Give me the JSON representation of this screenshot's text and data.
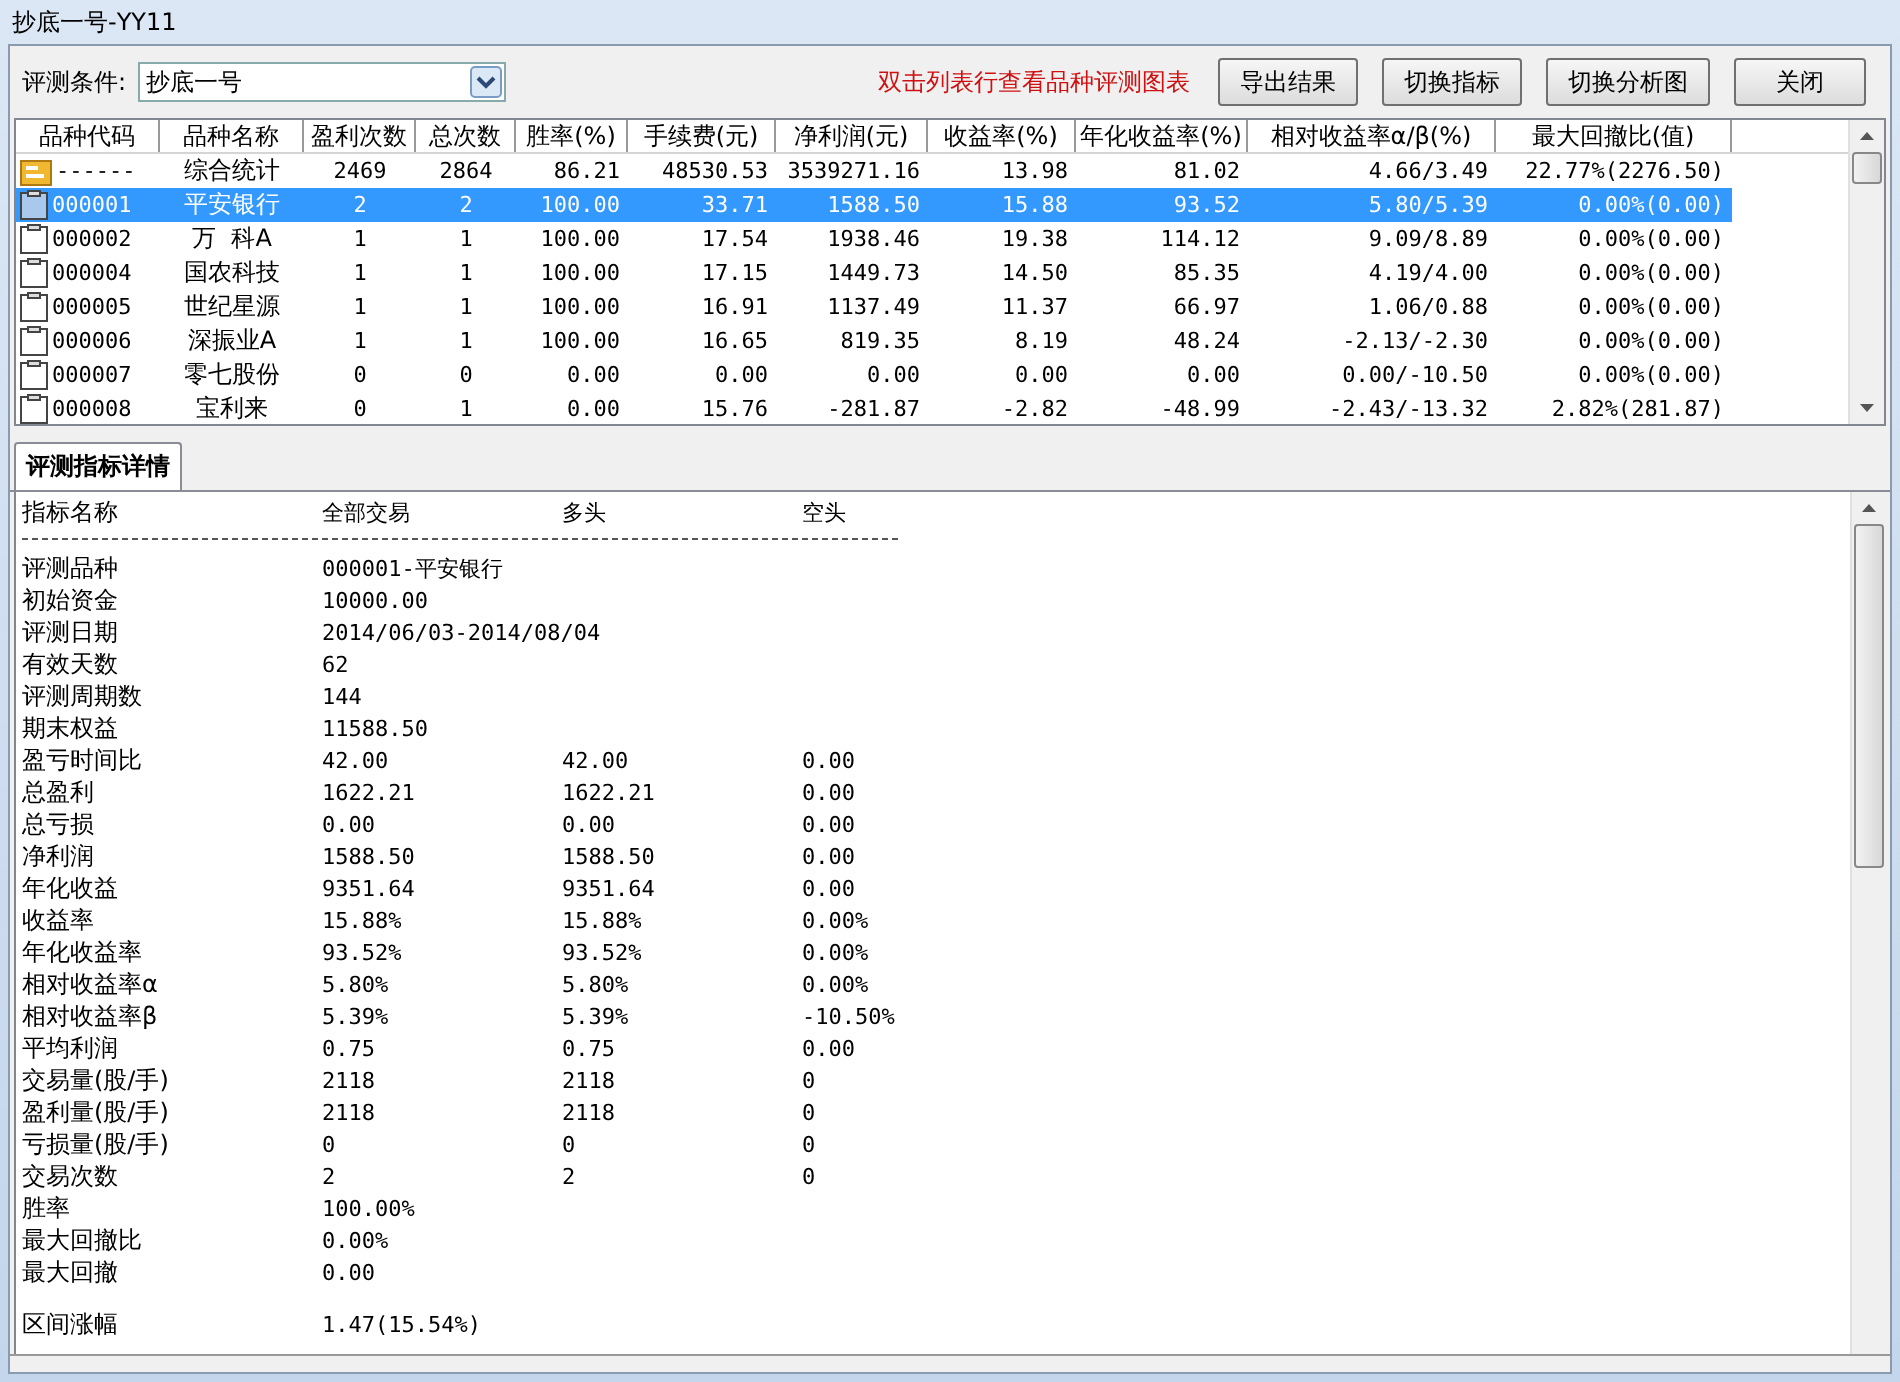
{
  "window": {
    "title": "抄底一号-YY11"
  },
  "toolbar": {
    "condition_label": "评测条件:",
    "condition_value": "抄底一号",
    "hint": "双击列表行查看品种评测图表",
    "buttons": [
      "导出结果",
      "切换指标",
      "切换分析图",
      "关闭"
    ]
  },
  "table": {
    "columns": [
      "品种代码",
      "品种名称",
      "盈利次数",
      "总次数",
      "胜率(%)",
      "手续费(元)",
      "净利润(元)",
      "收益率(%)",
      "年化收益率(%)",
      "相对收益率α/β(%)",
      "最大回撤比(值)"
    ],
    "rows": [
      {
        "kind": "summary",
        "selected": false,
        "cells": [
          "------",
          "综合统计",
          "2469",
          "2864",
          "86.21",
          "48530.53",
          "3539271.16",
          "13.98",
          "81.02",
          "4.66/3.49",
          "22.77%(2276.50)"
        ]
      },
      {
        "kind": "stock",
        "selected": true,
        "cells": [
          "000001",
          "平安银行",
          "2",
          "2",
          "100.00",
          "33.71",
          "1588.50",
          "15.88",
          "93.52",
          "5.80/5.39",
          "0.00%(0.00)"
        ]
      },
      {
        "kind": "stock",
        "selected": false,
        "cells": [
          "000002",
          "万  科A",
          "1",
          "1",
          "100.00",
          "17.54",
          "1938.46",
          "19.38",
          "114.12",
          "9.09/8.89",
          "0.00%(0.00)"
        ]
      },
      {
        "kind": "stock",
        "selected": false,
        "cells": [
          "000004",
          "国农科技",
          "1",
          "1",
          "100.00",
          "17.15",
          "1449.73",
          "14.50",
          "85.35",
          "4.19/4.00",
          "0.00%(0.00)"
        ]
      },
      {
        "kind": "stock",
        "selected": false,
        "cells": [
          "000005",
          "世纪星源",
          "1",
          "1",
          "100.00",
          "16.91",
          "1137.49",
          "11.37",
          "66.97",
          "1.06/0.88",
          "0.00%(0.00)"
        ]
      },
      {
        "kind": "stock",
        "selected": false,
        "cells": [
          "000006",
          "深振业A",
          "1",
          "1",
          "100.00",
          "16.65",
          "819.35",
          "8.19",
          "48.24",
          "-2.13/-2.30",
          "0.00%(0.00)"
        ]
      },
      {
        "kind": "stock",
        "selected": false,
        "cells": [
          "000007",
          "零七股份",
          "0",
          "0",
          "0.00",
          "0.00",
          "0.00",
          "0.00",
          "0.00",
          "0.00/-10.50",
          "0.00%(0.00)"
        ]
      },
      {
        "kind": "stock",
        "selected": false,
        "cells": [
          "000008",
          "宝利来",
          "0",
          "1",
          "0.00",
          "15.76",
          "-281.87",
          "-2.82",
          "-48.99",
          "-2.43/-13.32",
          "2.82%(281.87)"
        ]
      }
    ]
  },
  "tabs": [
    {
      "label": "评测指标详情",
      "selected": true
    }
  ],
  "detail": {
    "columns": [
      "指标名称",
      "全部交易",
      "多头",
      "空头"
    ],
    "rows": [
      [
        "评测品种",
        "000001-平安银行"
      ],
      [
        "初始资金",
        "10000.00"
      ],
      [
        "评测日期",
        "2014/06/03-2014/08/04"
      ],
      [
        "有效天数",
        "62"
      ],
      [
        "评测周期数",
        "144"
      ],
      [
        "期末权益",
        "11588.50"
      ],
      [
        "盈亏时间比",
        "42.00",
        "42.00",
        "0.00"
      ],
      [
        "总盈利",
        "1622.21",
        "1622.21",
        "0.00"
      ],
      [
        "总亏损",
        "0.00",
        "0.00",
        "0.00"
      ],
      [
        "净利润",
        "1588.50",
        "1588.50",
        "0.00"
      ],
      [
        "年化收益",
        "9351.64",
        "9351.64",
        "0.00"
      ],
      [
        "收益率",
        "15.88%",
        "15.88%",
        "0.00%"
      ],
      [
        "年化收益率",
        "93.52%",
        "93.52%",
        "0.00%"
      ],
      [
        "相对收益率α",
        "5.80%",
        "5.80%",
        "0.00%"
      ],
      [
        "相对收益率β",
        "5.39%",
        "5.39%",
        "-10.50%"
      ],
      [
        "平均利润",
        "0.75",
        "0.75",
        "0.00"
      ],
      [
        "交易量(股/手)",
        "2118",
        "2118",
        "0"
      ],
      [
        "盈利量(股/手)",
        "2118",
        "2118",
        "0"
      ],
      [
        "亏损量(股/手)",
        "0",
        "0",
        "0"
      ],
      [
        "交易次数",
        "2",
        "2",
        "0"
      ],
      [
        "胜率",
        "100.00%"
      ],
      [
        "最大回撤比",
        "0.00%"
      ],
      [
        "最大回撤",
        "0.00"
      ]
    ],
    "extra_rows": [
      [
        "区间涨幅",
        "1.47(15.54%)"
      ]
    ]
  }
}
